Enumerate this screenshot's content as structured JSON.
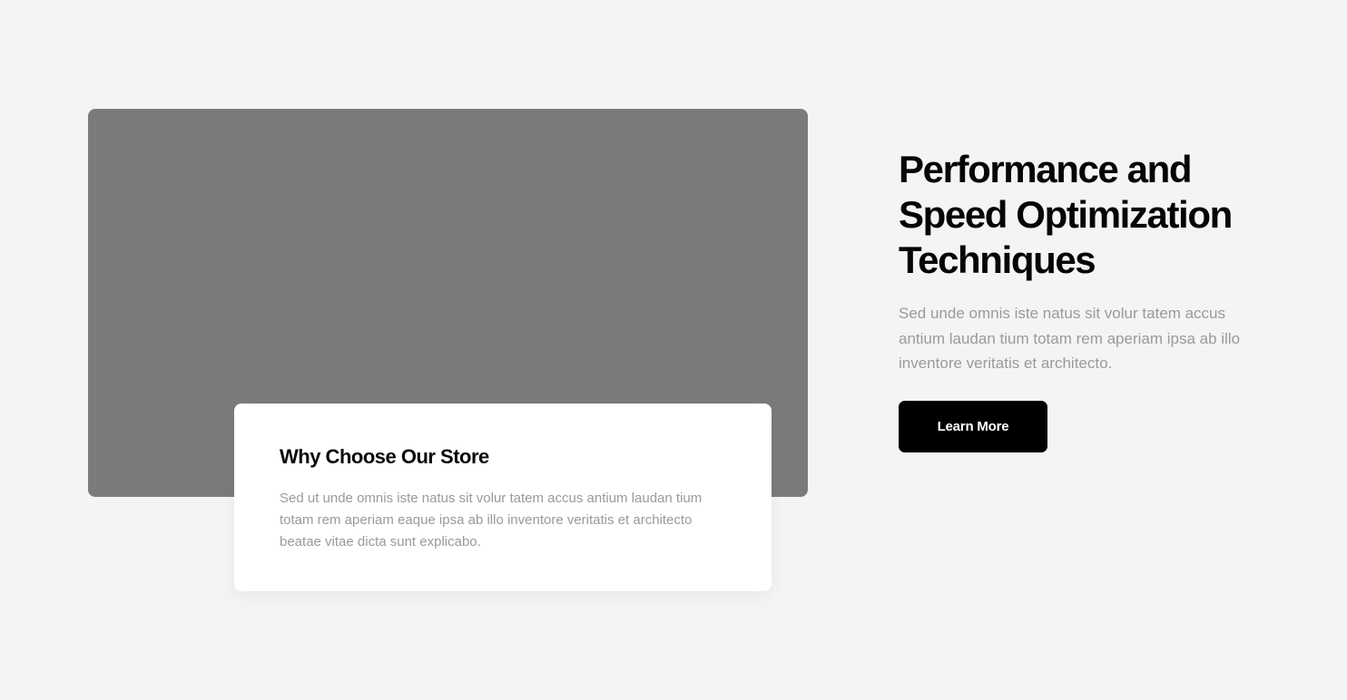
{
  "media": {
    "placeholder_color": "#7a7b7c"
  },
  "card": {
    "title": "Why Choose Our Store",
    "text": "Sed ut unde omnis iste natus sit volur tatem accus antium laudan tium totam rem aperiam eaque ipsa ab illo inventore veritatis et architecto beatae vitae dicta sunt explicabo."
  },
  "hero": {
    "headline": "Performance and Speed Optimization Techniques",
    "description": "Sed unde omnis iste natus sit volur tatem accus antium laudan tium totam rem aperiam ipsa ab illo inventore veritatis et architecto.",
    "button_label": "Learn More"
  },
  "colors": {
    "background": "#f4f4f4",
    "button": "#000000",
    "muted_text": "#9a9a9a"
  }
}
